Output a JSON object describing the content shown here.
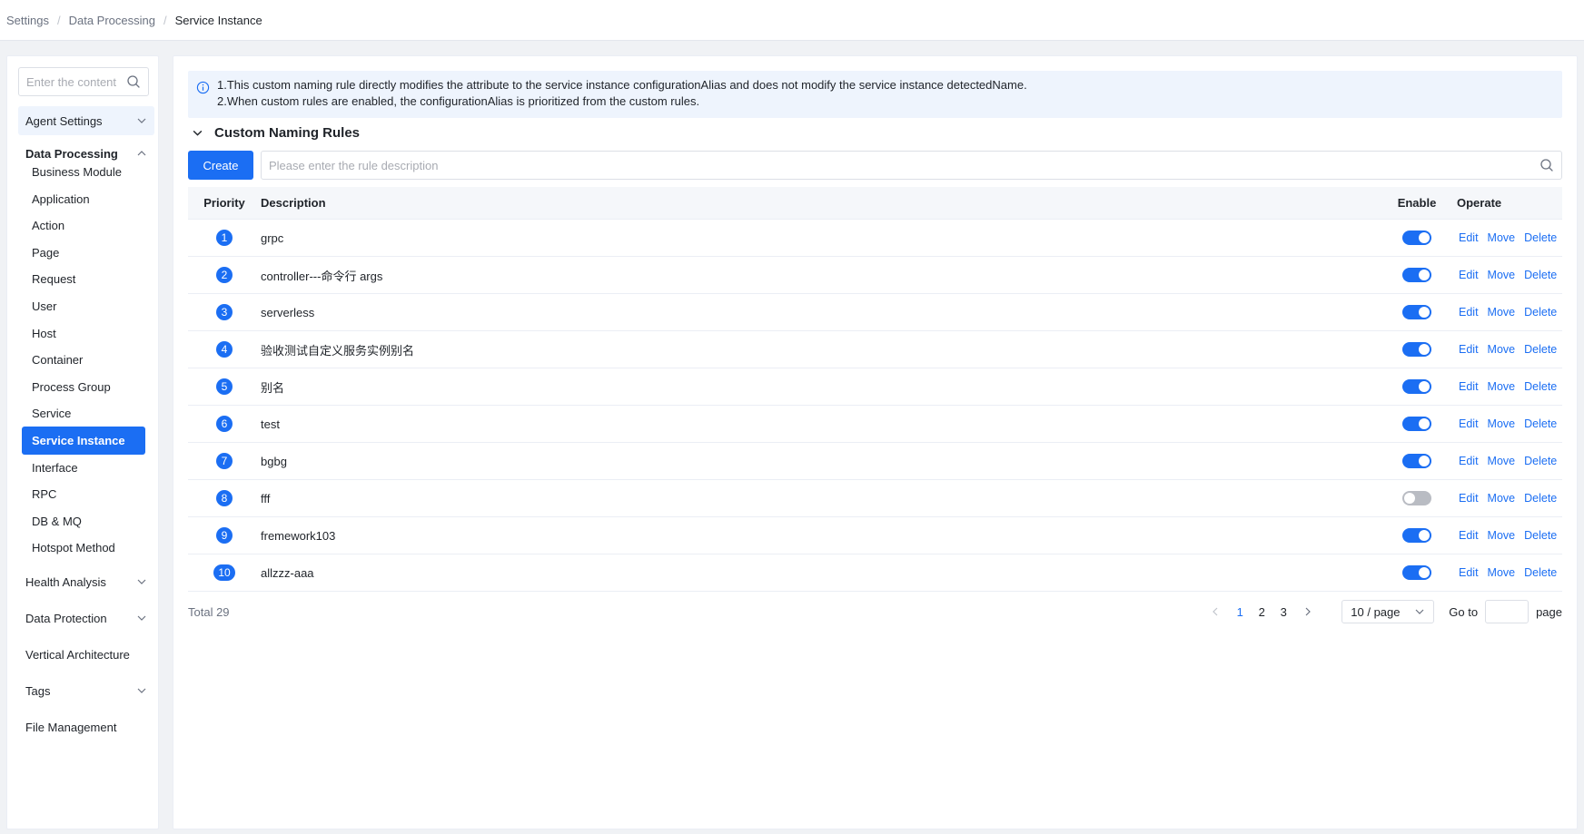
{
  "breadcrumb": [
    "Settings",
    "Data Processing",
    "Service Instance"
  ],
  "sidebar": {
    "search_placeholder": "Enter the content",
    "agent_settings": "Agent Settings",
    "data_processing": "Data Processing",
    "items": [
      "Business Module",
      "Application",
      "Action",
      "Page",
      "Request",
      "User",
      "Host",
      "Container",
      "Process Group",
      "Service",
      "Service Instance",
      "Interface",
      "RPC",
      "DB & MQ",
      "Hotspot Method"
    ],
    "active_item": "Service Instance",
    "health_analysis": "Health Analysis",
    "data_protection": "Data Protection",
    "vertical_architecture": "Vertical Architecture",
    "tags": "Tags",
    "file_management": "File Management"
  },
  "notice": {
    "line1": "1.This custom naming rule directly modifies the attribute to the service instance configurationAlias and does not modify the service instance detectedName.",
    "line2": "2.When custom rules are enabled, the configurationAlias is prioritized from the custom rules."
  },
  "section_title": "Custom Naming Rules",
  "create_label": "Create",
  "rule_search_placeholder": "Please enter the rule description",
  "table": {
    "headers": {
      "priority": "Priority",
      "description": "Description",
      "enable": "Enable",
      "operate": "Operate"
    },
    "rows": [
      {
        "priority": "1",
        "description": "grpc",
        "enabled": true
      },
      {
        "priority": "2",
        "description": "controller---命令行 args",
        "enabled": true
      },
      {
        "priority": "3",
        "description": "serverless",
        "enabled": true
      },
      {
        "priority": "4",
        "description": "验收测试自定义服务实例别名",
        "enabled": true
      },
      {
        "priority": "5",
        "description": "别名",
        "enabled": true
      },
      {
        "priority": "6",
        "description": "test",
        "enabled": true
      },
      {
        "priority": "7",
        "description": "bgbg",
        "enabled": true
      },
      {
        "priority": "8",
        "description": "fff",
        "enabled": false
      },
      {
        "priority": "9",
        "description": "fremework103",
        "enabled": true
      },
      {
        "priority": "10",
        "description": "allzzz-aaa",
        "enabled": true
      }
    ],
    "actions": {
      "edit": "Edit",
      "move": "Move",
      "delete": "Delete"
    }
  },
  "pagination": {
    "total": "Total 29",
    "pages": [
      "1",
      "2",
      "3"
    ],
    "current": "1",
    "page_size": "10 / page",
    "goto_label": "Go to",
    "page_label": "page"
  },
  "colors": {
    "primary": "#1b6ef3",
    "shade": "#eef4fd",
    "switch_off": "#b9bcc3"
  }
}
